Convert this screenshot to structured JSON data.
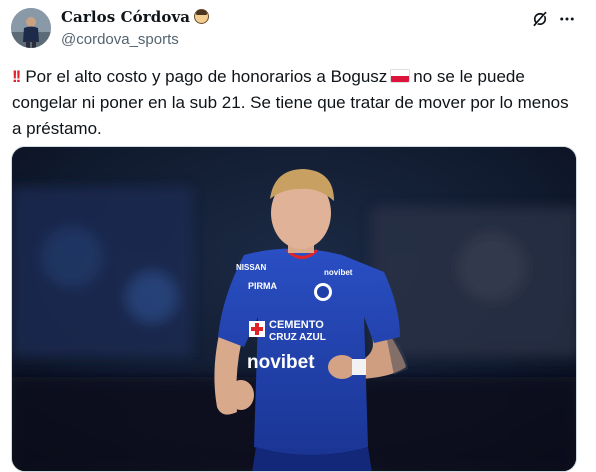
{
  "tweet": {
    "author": {
      "name": "Carlos Córdova",
      "handle": "@cordova_sports",
      "badge_icon": "bearded-face-emoji-icon"
    },
    "text_prefix_icon": "double-exclamation-icon",
    "text_before_flag": "Por el alto costo y pago de honorarios a Bogusz",
    "flag_icon": "poland-flag-icon",
    "text_after_flag": "no se le puede congelar ni poner en la sub 21. Se tiene que tratar de mover por lo menos a préstamo.",
    "header_icons": [
      "grok-icon",
      "more-icon"
    ]
  },
  "media": {
    "jersey_texts": {
      "kit_maker": "PIRMA",
      "sponsor_top": "CEMENTO",
      "sponsor_bottom": "CRUZ AZUL",
      "main_sponsor": "novibet",
      "sleeve_left": "NISSAN",
      "sleeve_right": "novibet"
    },
    "colors": {
      "jersey": "#1f3fa8",
      "background": "#0d1526",
      "accent": "#e0222b"
    }
  }
}
